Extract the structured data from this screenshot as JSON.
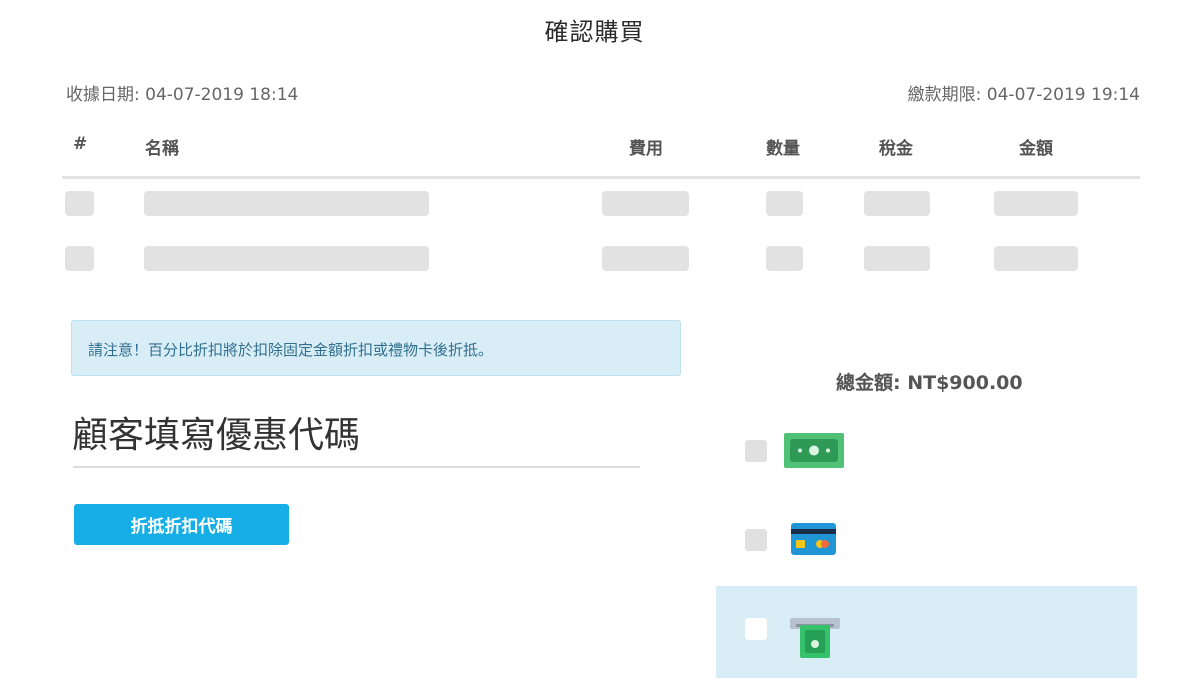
{
  "header": {
    "title": "確認購買",
    "receipt_date": "收據日期: 04-07-2019 18:14",
    "payment_deadline": "繳款期限: 04-07-2019 19:14"
  },
  "table": {
    "columns": [
      "#",
      "名稱",
      "費用",
      "數量",
      "稅金",
      "金額"
    ]
  },
  "notice": {
    "text": "請注意！百分比折扣將於扣除固定金額折扣或禮物卡後折抵。"
  },
  "coupon": {
    "heading": "顧客填寫優惠代碼",
    "apply_label": "折抵折扣代碼"
  },
  "summary": {
    "total": "總金額: NT$900.00"
  },
  "payment_methods": [
    {
      "icon": "cash-icon",
      "selected": false
    },
    {
      "icon": "credit-card-icon",
      "selected": false
    },
    {
      "icon": "atm-icon",
      "selected": true
    }
  ],
  "colors": {
    "accent": "#16aee7",
    "info_bg": "#d9edf7",
    "info_text": "#31708f",
    "skeleton": "#e2e2e2"
  }
}
